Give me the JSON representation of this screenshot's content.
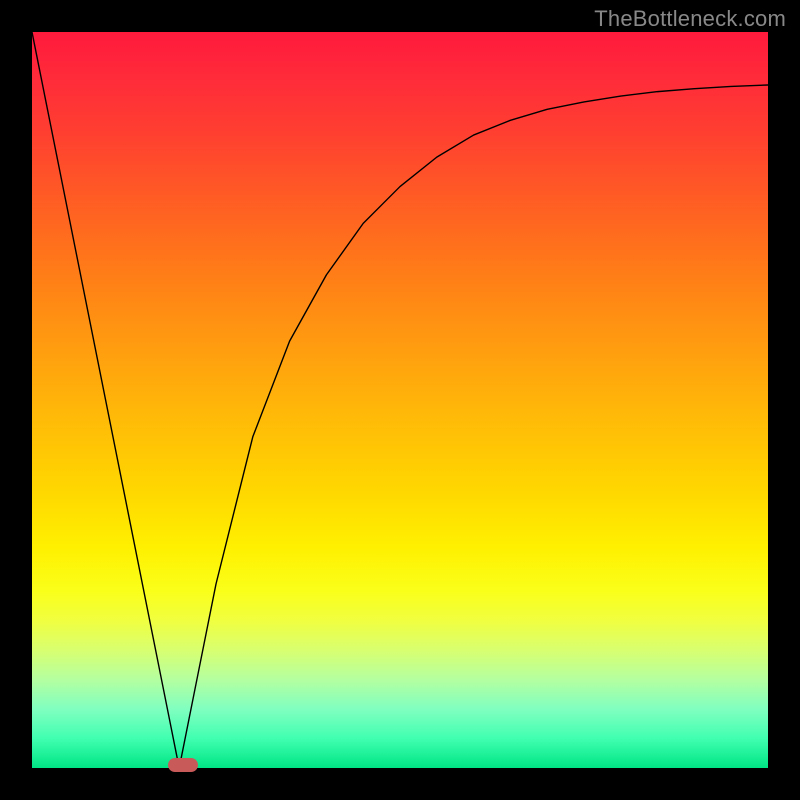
{
  "watermark": "TheBottleneck.com",
  "chart_data": {
    "type": "line",
    "title": "",
    "xlabel": "",
    "ylabel": "",
    "xlim": [
      0,
      100
    ],
    "ylim": [
      0,
      100
    ],
    "grid": false,
    "legend": false,
    "series": [
      {
        "name": "curve",
        "x": [
          0,
          5,
          10,
          15,
          18,
          20,
          22,
          25,
          30,
          35,
          40,
          45,
          50,
          55,
          60,
          65,
          70,
          75,
          80,
          85,
          90,
          95,
          100
        ],
        "values": [
          100,
          75,
          50,
          25,
          10,
          0,
          10,
          25,
          45,
          58,
          67,
          74,
          79,
          83,
          86,
          88,
          89.5,
          90.5,
          91.3,
          91.9,
          92.3,
          92.6,
          92.8
        ]
      }
    ],
    "markers": [
      {
        "name": "highlight",
        "x": 20.5,
        "y": 0
      }
    ],
    "background_gradient": {
      "top": "#ff1a3c",
      "mid": "#ffd600",
      "bottom": "#00e585"
    }
  }
}
